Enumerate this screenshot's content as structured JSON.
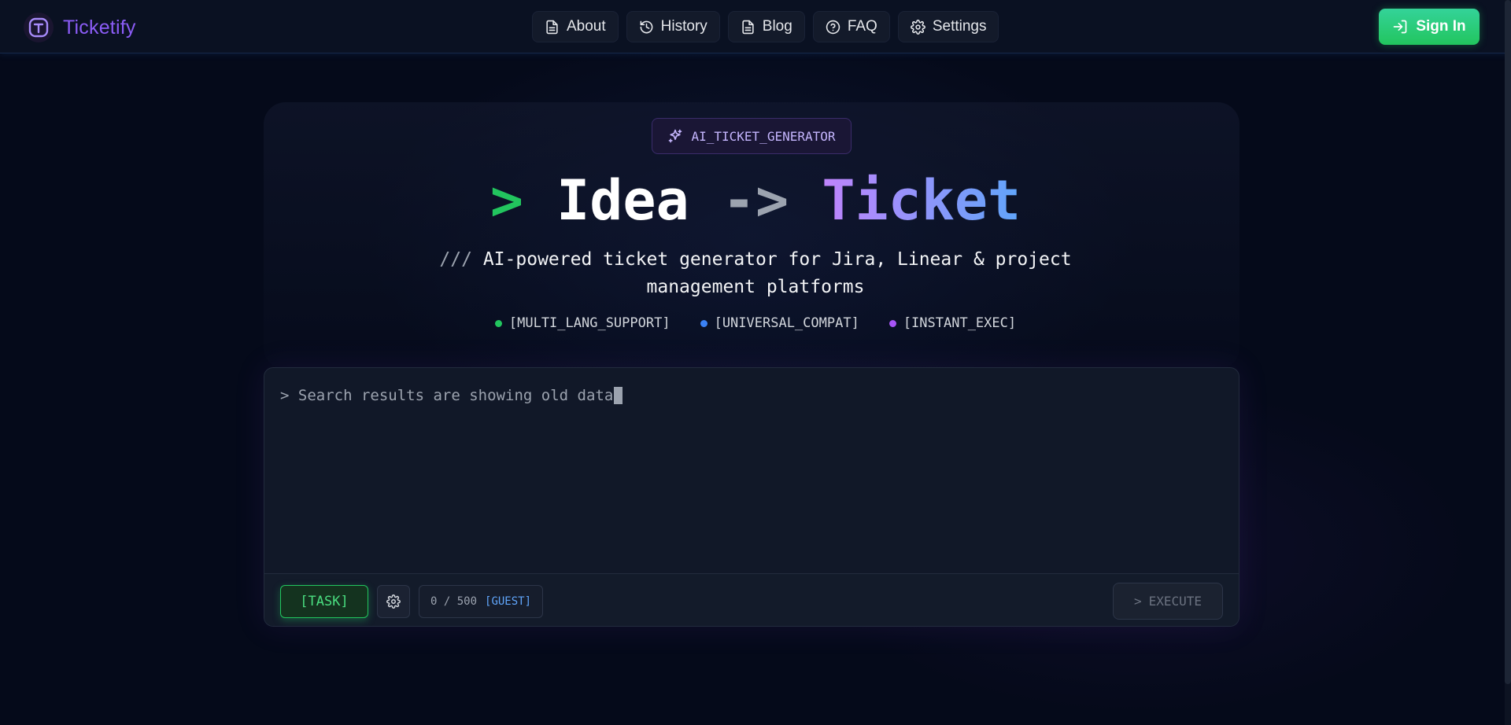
{
  "brand": {
    "name": "Ticketify",
    "logo_letter": "T"
  },
  "nav": {
    "items": [
      {
        "label": "About",
        "icon": "document-icon"
      },
      {
        "label": "History",
        "icon": "history-icon"
      },
      {
        "label": "Blog",
        "icon": "document-icon"
      },
      {
        "label": "FAQ",
        "icon": "help-circle-icon"
      },
      {
        "label": "Settings",
        "icon": "gear-icon"
      }
    ],
    "sign_in": "Sign In"
  },
  "hero": {
    "badge": "AI_TICKET_GENERATOR",
    "title_prompt": ">",
    "title_idea": "Idea",
    "title_arrow": "->",
    "title_ticket": "Ticket",
    "subtitle_prefix": "///",
    "subtitle": "AI-powered ticket generator for Jira, Linear & project management platforms",
    "features": [
      {
        "label": "[MULTI_LANG_SUPPORT]",
        "color": "#22c55e"
      },
      {
        "label": "[UNIVERSAL_COMPAT]",
        "color": "#3b82f6"
      },
      {
        "label": "[INSTANT_EXEC]",
        "color": "#a855f7"
      }
    ]
  },
  "editor": {
    "prompt": ">",
    "value": "Search results are showing old data",
    "mode_button": "[TASK]",
    "counter": "0 / 500",
    "tier": "[GUEST]",
    "execute_prompt": ">",
    "execute_label": "EXECUTE"
  },
  "colors": {
    "accent_green": "#22c55e",
    "accent_purple": "#8b5cf6",
    "accent_blue": "#60a5fa"
  }
}
